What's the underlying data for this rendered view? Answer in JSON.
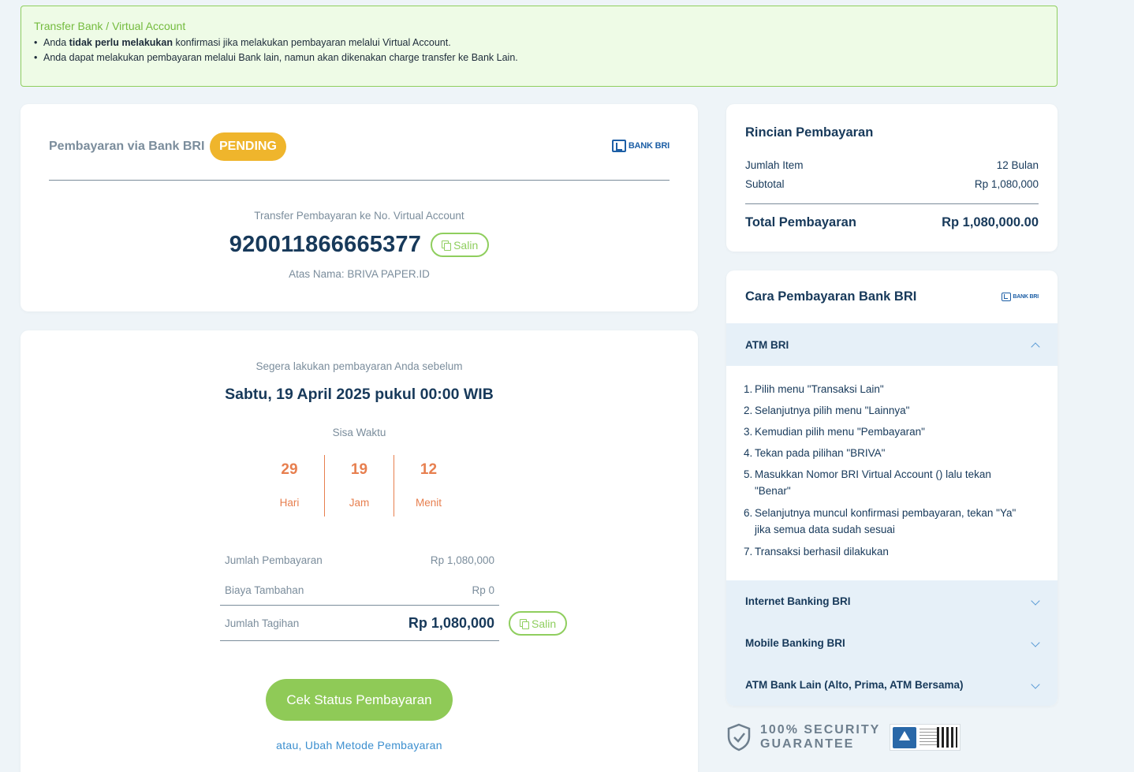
{
  "notice": {
    "title": "Transfer Bank / Virtual Account",
    "line1_prefix": "Anda ",
    "line1_bold": "tidak perlu melakukan",
    "line1_suffix": " konfirmasi jika melakukan pembayaran melalui Virtual Account.",
    "line2": "Anda dapat melakukan pembayaran melalui Bank lain, namun akan dikenakan charge transfer ke Bank Lain."
  },
  "va_card": {
    "title": "Pembayaran via Bank BRI",
    "status": "PENDING",
    "bank_logo_text": "BANK BRI",
    "va_label": "Transfer Pembayaran ke No. Virtual Account",
    "va_number": "920011866665377",
    "copy_label": "Salin",
    "owner": "Atas Nama: BRIVA PAPER.ID"
  },
  "deadline_card": {
    "label": "Segera lakukan pembayaran Anda sebelum",
    "date": "Sabtu, 19 April 2025 pukul 00:00 WIB",
    "remaining_label": "Sisa Waktu",
    "countdown": [
      {
        "value": "29",
        "unit": "Hari"
      },
      {
        "value": "19",
        "unit": "Jam"
      },
      {
        "value": "12",
        "unit": "Menit"
      }
    ],
    "summary": [
      {
        "label": "Jumlah Pembayaran",
        "amount": "Rp 1,080,000"
      },
      {
        "label": "Biaya Tambahan",
        "amount": "Rp 0"
      },
      {
        "label": "Jumlah Tagihan",
        "amount": "Rp 1,080,000"
      }
    ],
    "copy_label": "Salin",
    "check_button": "Cek Status Pembayaran",
    "change_method_link": "atau, Ubah Metode Pembayaran"
  },
  "rincian": {
    "title": "Rincian Pembayaran",
    "rows": [
      {
        "label": "Jumlah Item",
        "value": "12 Bulan"
      },
      {
        "label": "Subtotal",
        "value": "Rp 1,080,000"
      }
    ],
    "total_label": "Total Pembayaran",
    "total_value": "Rp 1,080,000.00"
  },
  "cara": {
    "title": "Cara Pembayaran Bank BRI",
    "bank_logo_text": "BANK BRI",
    "sections": [
      {
        "label": "ATM BRI",
        "expanded": true
      },
      {
        "label": "Internet Banking BRI",
        "expanded": false
      },
      {
        "label": "Mobile Banking BRI",
        "expanded": false
      },
      {
        "label": "ATM Bank Lain (Alto, Prima, ATM Bersama)",
        "expanded": false
      }
    ],
    "atm_steps": [
      "Pilih menu \"Transaksi Lain\"",
      "Selanjutnya pilih menu \"Lainnya\"",
      "Kemudian pilih menu \"Pembayaran\"",
      "Tekan pada pilihan \"BRIVA\"",
      "Masukkan Nomor BRI Virtual Account () lalu tekan \"Benar\"",
      "Selanjutnya muncul konfirmasi pembayaran, tekan \"Ya\" jika semua data sudah sesuai",
      "Transaksi berhasil dilakukan"
    ]
  },
  "security": {
    "line1": "100% SECURITY",
    "line2": "GUARANTEE"
  },
  "colors": {
    "accent_green": "#8fca57",
    "pending_badge": "#efb52c",
    "countdown": "#e77f4f",
    "link_blue": "#3c8fcf",
    "heading_navy": "#17395a"
  }
}
